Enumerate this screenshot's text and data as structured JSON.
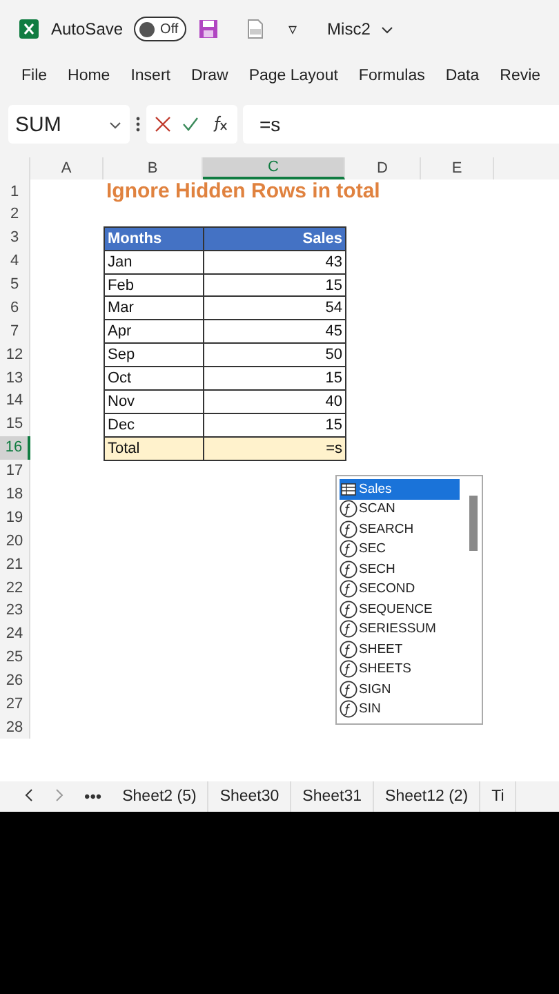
{
  "title_bar": {
    "autosave_label": "AutoSave",
    "autosave": {
      "on": false,
      "label": "Off"
    },
    "more": "▿",
    "file_name": "Misc2"
  },
  "ribbon_tabs": [
    {
      "label": "File",
      "selected": false
    },
    {
      "label": "Home",
      "selected": false
    },
    {
      "label": "Insert",
      "selected": false
    },
    {
      "label": "Draw",
      "selected": false
    },
    {
      "label": "Page Layout",
      "selected": false
    },
    {
      "label": "Formulas",
      "selected": false
    },
    {
      "label": "Data",
      "selected": false
    },
    {
      "label": "Revie",
      "selected": false
    }
  ],
  "formula_bar": {
    "name_box": "SUM",
    "formula": "=s"
  },
  "columns": [
    {
      "label": "A",
      "selected": false
    },
    {
      "label": "B",
      "selected": false
    },
    {
      "label": "C",
      "selected": true
    },
    {
      "label": "D",
      "selected": false
    },
    {
      "label": "E",
      "selected": false
    }
  ],
  "rows": [
    {
      "number": "1",
      "kind": "title",
      "b": "Ignore Hidden Rows in total",
      "selected": false
    },
    {
      "number": "2",
      "kind": "blank",
      "selected": false
    },
    {
      "number": "3",
      "kind": "header",
      "b": "Months",
      "c": "Sales",
      "selected": false
    },
    {
      "number": "4",
      "kind": "data",
      "b": "Jan",
      "c": "43",
      "selected": false
    },
    {
      "number": "5",
      "kind": "data",
      "b": "Feb",
      "c": "15",
      "selected": false
    },
    {
      "number": "6",
      "kind": "data",
      "b": "Mar",
      "c": "54",
      "selected": false
    },
    {
      "number": "7",
      "kind": "data",
      "b": "Apr",
      "c": "45",
      "selected": false
    },
    {
      "number": "12",
      "kind": "data",
      "b": "Sep",
      "c": "50",
      "selected": false
    },
    {
      "number": "13",
      "kind": "data",
      "b": "Oct",
      "c": "15",
      "selected": false
    },
    {
      "number": "14",
      "kind": "data",
      "b": "Nov",
      "c": "40",
      "selected": false
    },
    {
      "number": "15",
      "kind": "data",
      "b": "Dec",
      "c": "15",
      "selected": false
    },
    {
      "number": "16",
      "kind": "total",
      "b": "Total",
      "c": "=s",
      "selected": true
    },
    {
      "number": "17",
      "kind": "blank",
      "selected": false
    },
    {
      "number": "18",
      "kind": "blank",
      "selected": false
    },
    {
      "number": "19",
      "kind": "blank",
      "selected": false
    },
    {
      "number": "20",
      "kind": "blank",
      "selected": false
    },
    {
      "number": "21",
      "kind": "blank",
      "selected": false
    },
    {
      "number": "22",
      "kind": "blank",
      "selected": false
    },
    {
      "number": "23",
      "kind": "blank",
      "selected": false
    },
    {
      "number": "24",
      "kind": "blank",
      "selected": false
    },
    {
      "number": "25",
      "kind": "blank",
      "selected": false
    },
    {
      "number": "26",
      "kind": "blank",
      "selected": false
    },
    {
      "number": "27",
      "kind": "blank",
      "selected": false
    },
    {
      "number": "28",
      "kind": "blank",
      "selected": false
    }
  ],
  "autocomplete": [
    {
      "label": "Sales",
      "kind": "table",
      "selected": true
    },
    {
      "label": "SCAN",
      "kind": "function",
      "selected": false
    },
    {
      "label": "SEARCH",
      "kind": "function",
      "selected": false
    },
    {
      "label": "SEC",
      "kind": "function",
      "selected": false
    },
    {
      "label": "SECH",
      "kind": "function",
      "selected": false
    },
    {
      "label": "SECOND",
      "kind": "function",
      "selected": false
    },
    {
      "label": "SEQUENCE",
      "kind": "function",
      "selected": false
    },
    {
      "label": "SERIESSUM",
      "kind": "function",
      "selected": false
    },
    {
      "label": "SHEET",
      "kind": "function",
      "selected": false
    },
    {
      "label": "SHEETS",
      "kind": "function",
      "selected": false
    },
    {
      "label": "SIGN",
      "kind": "function",
      "selected": false
    },
    {
      "label": "SIN",
      "kind": "function",
      "selected": false
    }
  ],
  "sheet_nav": {
    "more": "•••"
  },
  "sheet_tabs": [
    {
      "label": "Sheet2 (5)",
      "selected": false
    },
    {
      "label": "Sheet30",
      "selected": false
    },
    {
      "label": "Sheet31",
      "selected": false
    },
    {
      "label": "Sheet12 (2)",
      "selected": false
    },
    {
      "label": "Ti",
      "selected": false
    }
  ]
}
